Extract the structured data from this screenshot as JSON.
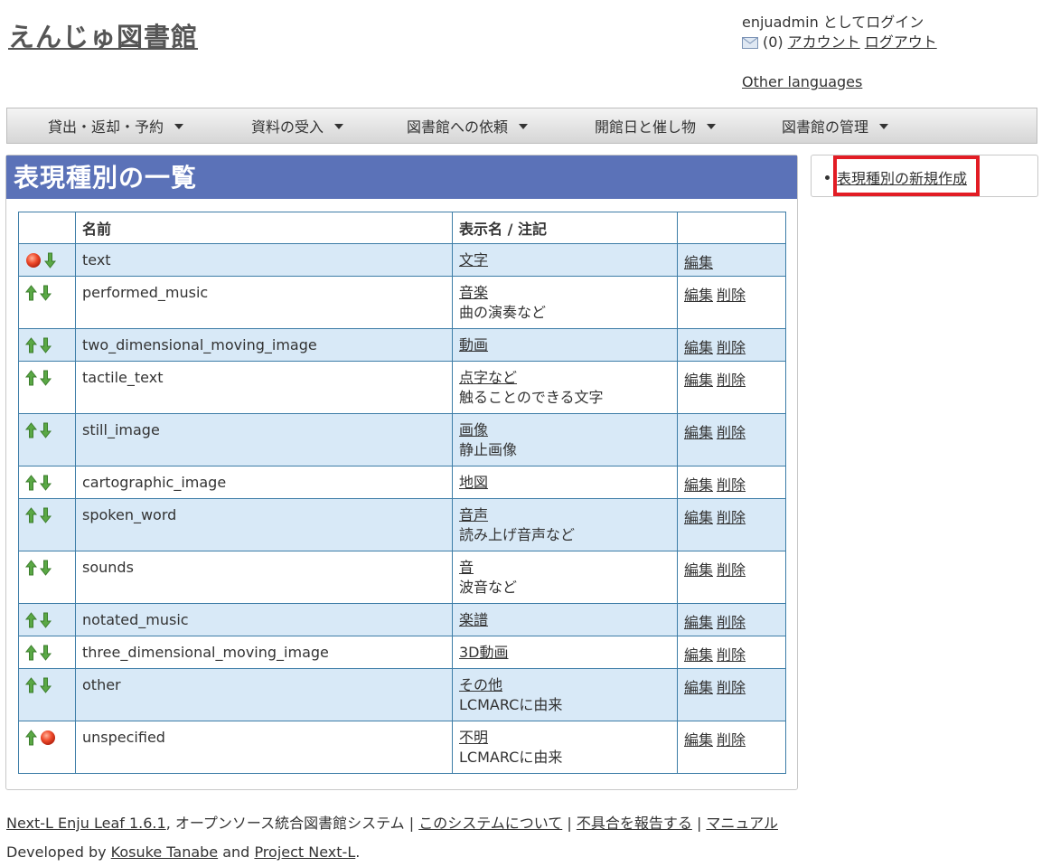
{
  "header": {
    "site_title": "えんじゅ図書館",
    "login_text": "enjuadmin としてログイン",
    "message_count": "(0)",
    "account_link": "アカウント",
    "logout_link": "ログアウト",
    "other_languages": "Other languages"
  },
  "nav": {
    "items": [
      {
        "label": "貸出・返却・予約"
      },
      {
        "label": "資料の受入"
      },
      {
        "label": "図書館への依頼"
      },
      {
        "label": "開館日と催し物"
      },
      {
        "label": "図書館の管理"
      }
    ]
  },
  "main": {
    "title": "表現種別の一覧",
    "columns": {
      "name": "名前",
      "display": "表示名 / 注記"
    },
    "edit_label": "編集",
    "delete_label": "削除",
    "rows": [
      {
        "name": "text",
        "display": "文字",
        "note": "",
        "up": false,
        "down": true
      },
      {
        "name": "performed_music",
        "display": "音楽",
        "note": "曲の演奏など",
        "up": true,
        "down": true
      },
      {
        "name": "two_dimensional_moving_image",
        "display": "動画",
        "note": "",
        "up": true,
        "down": true
      },
      {
        "name": "tactile_text",
        "display": "点字など",
        "note": "触ることのできる文字",
        "up": true,
        "down": true
      },
      {
        "name": "still_image",
        "display": "画像",
        "note": "静止画像",
        "up": true,
        "down": true
      },
      {
        "name": "cartographic_image",
        "display": "地図",
        "note": "",
        "up": true,
        "down": true
      },
      {
        "name": "spoken_word",
        "display": "音声",
        "note": "読み上げ音声など",
        "up": true,
        "down": true
      },
      {
        "name": "sounds",
        "display": "音",
        "note": "波音など",
        "up": true,
        "down": true
      },
      {
        "name": "notated_music",
        "display": "楽譜",
        "note": "",
        "up": true,
        "down": true
      },
      {
        "name": "three_dimensional_moving_image",
        "display": "3D動画",
        "note": "",
        "up": true,
        "down": true
      },
      {
        "name": "other",
        "display": "その他",
        "note": "LCMARCに由来",
        "up": true,
        "down": true
      },
      {
        "name": "unspecified",
        "display": "不明",
        "note": "LCMARCに由来",
        "up": true,
        "down": false
      }
    ]
  },
  "sidebar": {
    "new_link": "表現種別の新規作成"
  },
  "footer": {
    "product_link": "Next-L Enju Leaf 1.6.1",
    "product_desc": ", オープンソース統合図書館システム",
    "sep": "|",
    "about_link": "このシステムについて",
    "report_link": "不具合を報告する",
    "manual_link": "マニュアル",
    "developed_by": "Developed by",
    "author_link": "Kosuke Tanabe",
    "and": "and",
    "project_link": "Project Next-L",
    "period": "."
  },
  "colors": {
    "title_bar": "#5b72b8",
    "row_alt": "#d8e9f7",
    "table_border": "#3d7da7",
    "highlight": "#e21c24",
    "arrow_green": "#4a9a3a",
    "stop_red": "#e8432a"
  },
  "icons": {
    "up": "arrow-up-icon",
    "down": "arrow-down-icon",
    "stop": "stop-dot-icon",
    "mail": "mail-icon"
  }
}
